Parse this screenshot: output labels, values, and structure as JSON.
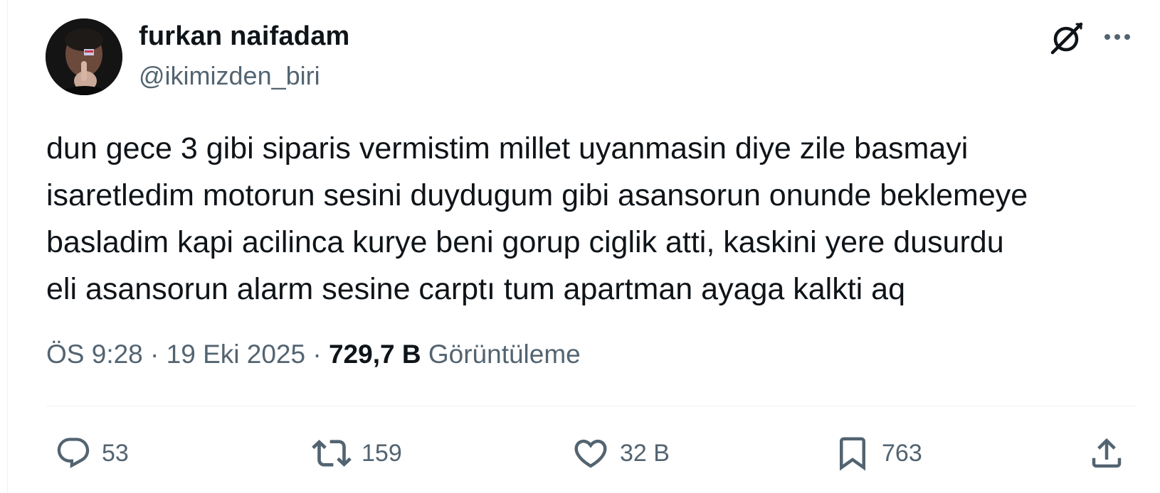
{
  "author": {
    "name": "furkan naifadam",
    "handle": "@ikimizden_biri"
  },
  "tweet": {
    "text": "dun gece 3 gibi siparis vermistim millet uyanmasin diye zile basmayi\nisaretledim motorun sesini duydugum gibi asansorun onunde beklemeye\nbasladim kapi acilinca kurye beni gorup ciglik atti, kaskini yere dusurdu\neli asansorun alarm sesine carptı tum apartman ayaga kalkti aq"
  },
  "meta": {
    "time": "ÖS 9:28",
    "separator1": " · ",
    "date": "19 Eki 2025",
    "separator2": " · ",
    "views_count": "729,7 B",
    "views_label": " Görüntüleme"
  },
  "actions": {
    "replies": "53",
    "retweets": "159",
    "likes": "32 B",
    "bookmarks": "763"
  },
  "icons": {
    "header": [
      "grok-icon",
      "more-icon"
    ],
    "actions": [
      "reply-icon",
      "retweet-icon",
      "like-icon",
      "bookmark-icon",
      "share-icon"
    ]
  },
  "colors": {
    "text": "#0f1419",
    "secondary": "#536471",
    "divider": "#eff3f4"
  }
}
